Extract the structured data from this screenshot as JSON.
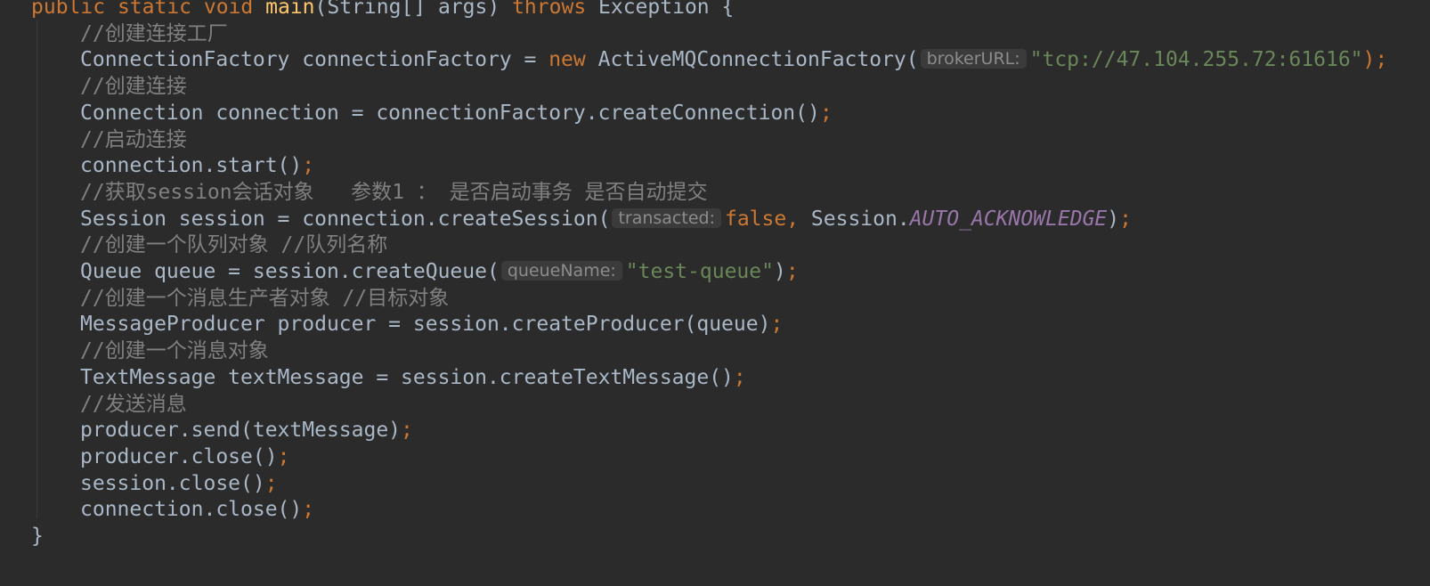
{
  "lines": [
    {
      "indent": 1,
      "tokens": [
        {
          "t": "public ",
          "c": "kw"
        },
        {
          "t": "static ",
          "c": "kw"
        },
        {
          "t": "void ",
          "c": "kw"
        },
        {
          "t": "main",
          "c": "fn"
        },
        {
          "t": "(String[] args) ",
          "c": ""
        },
        {
          "t": "throws ",
          "c": "kw"
        },
        {
          "t": "Exception {",
          "c": ""
        }
      ]
    },
    {
      "indent": 2,
      "tokens": [
        {
          "t": "//创建连接工厂",
          "c": "cmt"
        }
      ]
    },
    {
      "indent": 2,
      "tokens": [
        {
          "t": "ConnectionFactory connectionFactory = ",
          "c": ""
        },
        {
          "t": "new ",
          "c": "kw"
        },
        {
          "t": "ActiveMQConnectionFactory(",
          "c": ""
        },
        {
          "t": "brokerURL:",
          "c": "hint"
        },
        {
          "t": "\"tcp://47.104.255.72:61616\"",
          "c": "str"
        },
        {
          "t": ");",
          "c": "kw"
        }
      ]
    },
    {
      "indent": 2,
      "tokens": [
        {
          "t": "//创建连接",
          "c": "cmt"
        }
      ]
    },
    {
      "indent": 2,
      "tokens": [
        {
          "t": "Connection connection = connectionFactory.createConnection()",
          "c": ""
        },
        {
          "t": ";",
          "c": "kw"
        }
      ]
    },
    {
      "indent": 2,
      "tokens": [
        {
          "t": "//启动连接",
          "c": "cmt"
        }
      ]
    },
    {
      "indent": 2,
      "tokens": [
        {
          "t": "connection.start()",
          "c": ""
        },
        {
          "t": ";",
          "c": "kw"
        }
      ]
    },
    {
      "indent": 2,
      "tokens": [
        {
          "t": "//获取session会话对象   参数1 ： 是否启动事务 是否自动提交",
          "c": "cmt"
        }
      ]
    },
    {
      "indent": 2,
      "tokens": [
        {
          "t": "Session session = connection.createSession(",
          "c": ""
        },
        {
          "t": "transacted:",
          "c": "hint"
        },
        {
          "t": "false, ",
          "c": "kw"
        },
        {
          "t": "Session.",
          "c": ""
        },
        {
          "t": "AUTO_ACKNOWLEDGE",
          "c": "const"
        },
        {
          "t": ")",
          "c": ""
        },
        {
          "t": ";",
          "c": "kw"
        }
      ]
    },
    {
      "indent": 2,
      "tokens": [
        {
          "t": "//创建一个队列对象 //队列名称",
          "c": "cmt"
        }
      ]
    },
    {
      "indent": 2,
      "tokens": [
        {
          "t": "Queue queue = session.createQueue(",
          "c": ""
        },
        {
          "t": "queueName:",
          "c": "hint"
        },
        {
          "t": "\"test-queue\"",
          "c": "str"
        },
        {
          "t": ")",
          "c": ""
        },
        {
          "t": ";",
          "c": "kw"
        }
      ]
    },
    {
      "indent": 2,
      "tokens": [
        {
          "t": "//创建一个消息生产者对象 //目标对象",
          "c": "cmt"
        }
      ]
    },
    {
      "indent": 2,
      "tokens": [
        {
          "t": "MessageProducer producer = session.createProducer(queue)",
          "c": ""
        },
        {
          "t": ";",
          "c": "kw"
        }
      ]
    },
    {
      "indent": 2,
      "tokens": [
        {
          "t": "//创建一个消息对象",
          "c": "cmt"
        }
      ]
    },
    {
      "indent": 2,
      "tokens": [
        {
          "t": "TextMessage textMessage = session.createTextMessage()",
          "c": ""
        },
        {
          "t": ";",
          "c": "kw"
        }
      ]
    },
    {
      "indent": 2,
      "tokens": [
        {
          "t": "//发送消息",
          "c": "cmt"
        }
      ]
    },
    {
      "indent": 2,
      "tokens": [
        {
          "t": "producer.send(textMessage)",
          "c": ""
        },
        {
          "t": ";",
          "c": "kw"
        }
      ]
    },
    {
      "indent": 2,
      "tokens": [
        {
          "t": "producer.close()",
          "c": ""
        },
        {
          "t": ";",
          "c": "kw"
        }
      ]
    },
    {
      "indent": 2,
      "tokens": [
        {
          "t": "session.close()",
          "c": ""
        },
        {
          "t": ";",
          "c": "kw"
        }
      ]
    },
    {
      "indent": 2,
      "tokens": [
        {
          "t": "connection.close()",
          "c": ""
        },
        {
          "t": ";",
          "c": "kw"
        }
      ]
    },
    {
      "indent": 1,
      "tokens": [
        {
          "t": "}",
          "c": ""
        }
      ]
    }
  ],
  "colors": {
    "background": "#2b2b2b",
    "default": "#a9b7c6",
    "keyword": "#cc7832",
    "method": "#ffc66d",
    "string": "#6a8759",
    "comment": "#808080",
    "constant": "#9876aa"
  }
}
